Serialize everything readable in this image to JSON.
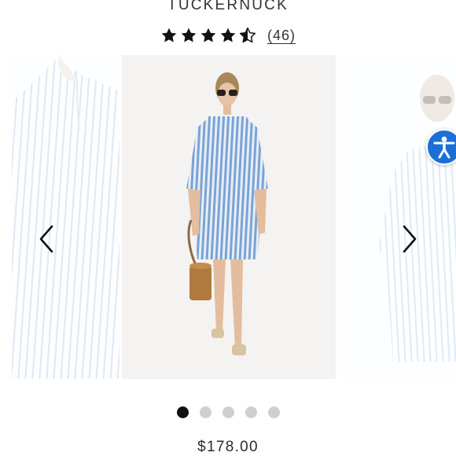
{
  "product": {
    "brand": "TUCKERNUCK",
    "rating": 4.5,
    "review_count": "(46)",
    "price": "$178.00"
  },
  "carousel": {
    "slide_count": 5,
    "active_index": 0,
    "main_image": "model-in-blue-white-striped-dress-image",
    "prev_image": "dress-closeup-image",
    "next_image": "dress-alternate-view-image"
  },
  "icons": {
    "prev": "chevron-left-icon",
    "next": "chevron-right-icon",
    "accessibility": "accessibility-icon",
    "star": "star-icon"
  },
  "colors": {
    "accessibility_button": "#1c6fd6",
    "dot_active": "#111111",
    "dot_inactive": "#cfcfcf",
    "stripe_blue": "#7aa3d3"
  }
}
